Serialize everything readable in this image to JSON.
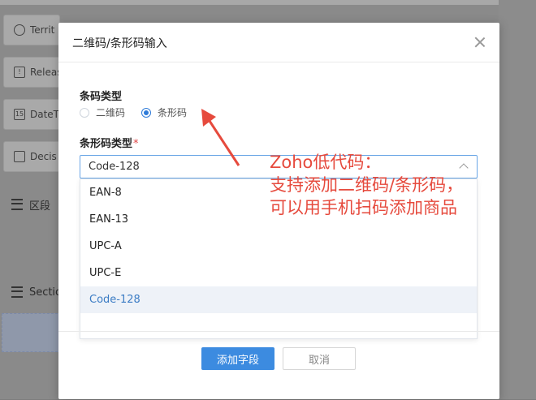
{
  "background": {
    "items": [
      {
        "icon": "search-icon",
        "label": "Territ"
      },
      {
        "icon": "release-icon",
        "label": "Releas"
      },
      {
        "icon": "calendar-icon",
        "label": "DateT"
      },
      {
        "icon": "decision-icon",
        "label": "Decis"
      }
    ],
    "sections": [
      "区段",
      "Sectio"
    ]
  },
  "modal": {
    "title": "二维码/条形码输入",
    "barcode_type_label": "条码类型",
    "radio_options": [
      {
        "label": "二维码",
        "checked": false
      },
      {
        "label": "条形码",
        "checked": true
      }
    ],
    "barcode_format_label": "条形码类型",
    "required_mark": "*",
    "select_value": "Code-128",
    "dropdown_options": [
      "EAN-8",
      "EAN-13",
      "UPC-A",
      "UPC-E",
      "Code-128"
    ],
    "selected_option": "Code-128",
    "add_field_label": "添加字段",
    "cancel_label": "取消"
  },
  "annotation": {
    "lines": [
      "Zoho低代码：",
      "支持添加二维码/条形码，",
      "可以用手机扫码添加商品"
    ],
    "color": "#e64a3d"
  },
  "colors": {
    "primary": "#3c8be0",
    "selected_text": "#3b7cc4"
  }
}
